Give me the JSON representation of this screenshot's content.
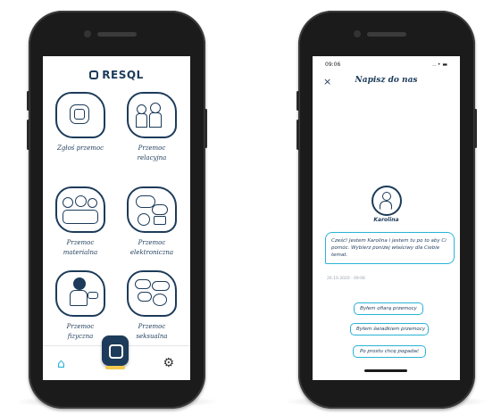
{
  "left_phone": {
    "brand": "RESQL",
    "tiles": [
      {
        "label_line1": "Zgłoś przemoc",
        "label_line2": ""
      },
      {
        "label_line1": "Przemoc",
        "label_line2": "relacyjna"
      },
      {
        "label_line1": "Przemoc",
        "label_line2": "materialna"
      },
      {
        "label_line1": "Przemoc",
        "label_line2": "elektroniczna"
      },
      {
        "label_line1": "Przemoc",
        "label_line2": "fizyczna"
      },
      {
        "label_line1": "Przemoc",
        "label_line2": "seksualna"
      }
    ],
    "tabbar": {
      "home_icon": "home-icon",
      "center_icon": "resql-icon",
      "settings_icon": "gear-icon"
    },
    "colors": {
      "navy": "#1d3b5a",
      "accent": "#29b3d6",
      "yellow": "#f2c94c"
    }
  },
  "right_phone": {
    "status_time": "09:06",
    "status_icons": ".. • ▬",
    "header": {
      "close": "×",
      "title": "Napisz do nas"
    },
    "agent_name": "Karolina",
    "message": "Cześć! Jestem Karolina i jestem tu po to aby Ci pomóc. Wybierz poniżej właściwy dla Ciebie temat.",
    "timestamp": "26.10.2020 · 09:06",
    "options": [
      "Byłem ofiarą przemocy",
      "Byłem świadkiem przemocy",
      "Po prostu chcę pogadać"
    ]
  }
}
